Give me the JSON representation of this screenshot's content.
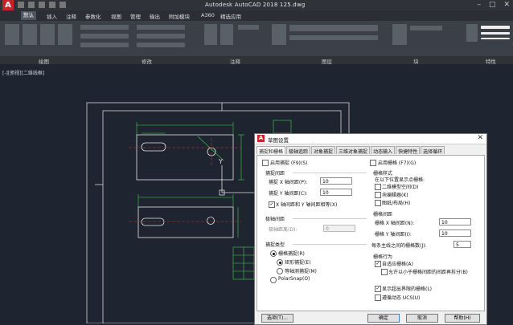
{
  "window": {
    "title": "Autodesk AutoCAD 2018    125.dwg",
    "logo": "A"
  },
  "menu": {
    "tabs": [
      "默认",
      "插入",
      "注释",
      "参数化",
      "视图",
      "管理",
      "输出",
      "附加模块",
      "A360",
      "精选应用"
    ]
  },
  "ribbon": {
    "panels": [
      "绘图",
      "修改",
      "注释",
      "图层",
      "块",
      "特性"
    ]
  },
  "viewport": {
    "label": "[-][俯视][二维线框]"
  },
  "dialog": {
    "title": "草图设置",
    "close": "✕",
    "tabs": [
      "捕捉和栅格",
      "极轴追踪",
      "对象捕捉",
      "三维对象捕捉",
      "动态输入",
      "快捷特性",
      "选择循环"
    ],
    "snap": {
      "enable": "启用捕捉 (F9)(S)",
      "spacing_title": "捕捉间距",
      "x_label": "捕捉 X 轴间距(P):",
      "x_value": "10",
      "y_label": "捕捉 Y 轴间距(C):",
      "y_value": "10",
      "equal": "X 轴间距和 Y 轴间距相等(X)",
      "polar_title": "极轴间距",
      "polar_label": "极轴距离(D):",
      "polar_value": "0",
      "type_title": "捕捉类型",
      "grid_snap": "栅格捕捉(R)",
      "rect_snap": "矩形捕捉(E)",
      "iso_snap": "等轴测捕捉(M)",
      "polar_snap": "PolarSnap(O)"
    },
    "grid": {
      "enable": "启用栅格 (F7)(G)",
      "style_title": "栅格样式",
      "style_desc": "在以下位置显示点栅格:",
      "model": "二维模型空间(D)",
      "block_editor": "块编辑器(K)",
      "sheet": "图纸/布局(H)",
      "spacing_title": "栅格间距",
      "x_label": "栅格 X 轴间距(N):",
      "x_value": "10",
      "y_label": "栅格 Y 轴间距(I):",
      "y_value": "10",
      "major_label": "每条主线之间的栅格数(J):",
      "major_value": "5",
      "behavior_title": "栅格行为",
      "adaptive": "自适应栅格(A)",
      "subdivide": "允许以小于栅格间距的间距再拆分(B)",
      "beyond": "显示超出界限的栅格(L)",
      "follow_ucs": "遵循动态 UCS(U)"
    },
    "buttons": {
      "options": "选项(T)...",
      "ok": "确定",
      "cancel": "取消",
      "help": "帮助(H)"
    },
    "checked_mark": "✓"
  }
}
